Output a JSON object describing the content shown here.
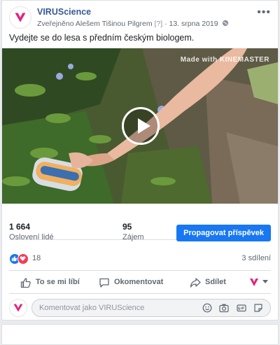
{
  "post": {
    "page_name": "VIRUScience",
    "meta_published": "Zveřejněno Alešem Tišinou Pilgrem",
    "meta_help": "[?]",
    "meta_sep": "·",
    "meta_date": "13. srpna 2019",
    "more_icon": "•••",
    "text": "Vydejte se do lesa s předním českým biologem."
  },
  "video": {
    "watermark": "Made with KINEMASTER"
  },
  "stats": {
    "reach_value": "1 664",
    "reach_label": "Oslovení lidé",
    "engagement_value": "95",
    "engagement_label": "Zájem",
    "promote_label": "Propagovat příspěvek"
  },
  "reactions": {
    "count": "18",
    "shares": "3 sdílení"
  },
  "actions": {
    "like": "To se mi líbí",
    "comment": "Okomentovat",
    "share": "Sdílet"
  },
  "comment": {
    "placeholder": "Komentovat jako VIRUScience"
  },
  "colors": {
    "brand": "#e4217d",
    "link": "#385898",
    "primary": "#1877f2"
  }
}
